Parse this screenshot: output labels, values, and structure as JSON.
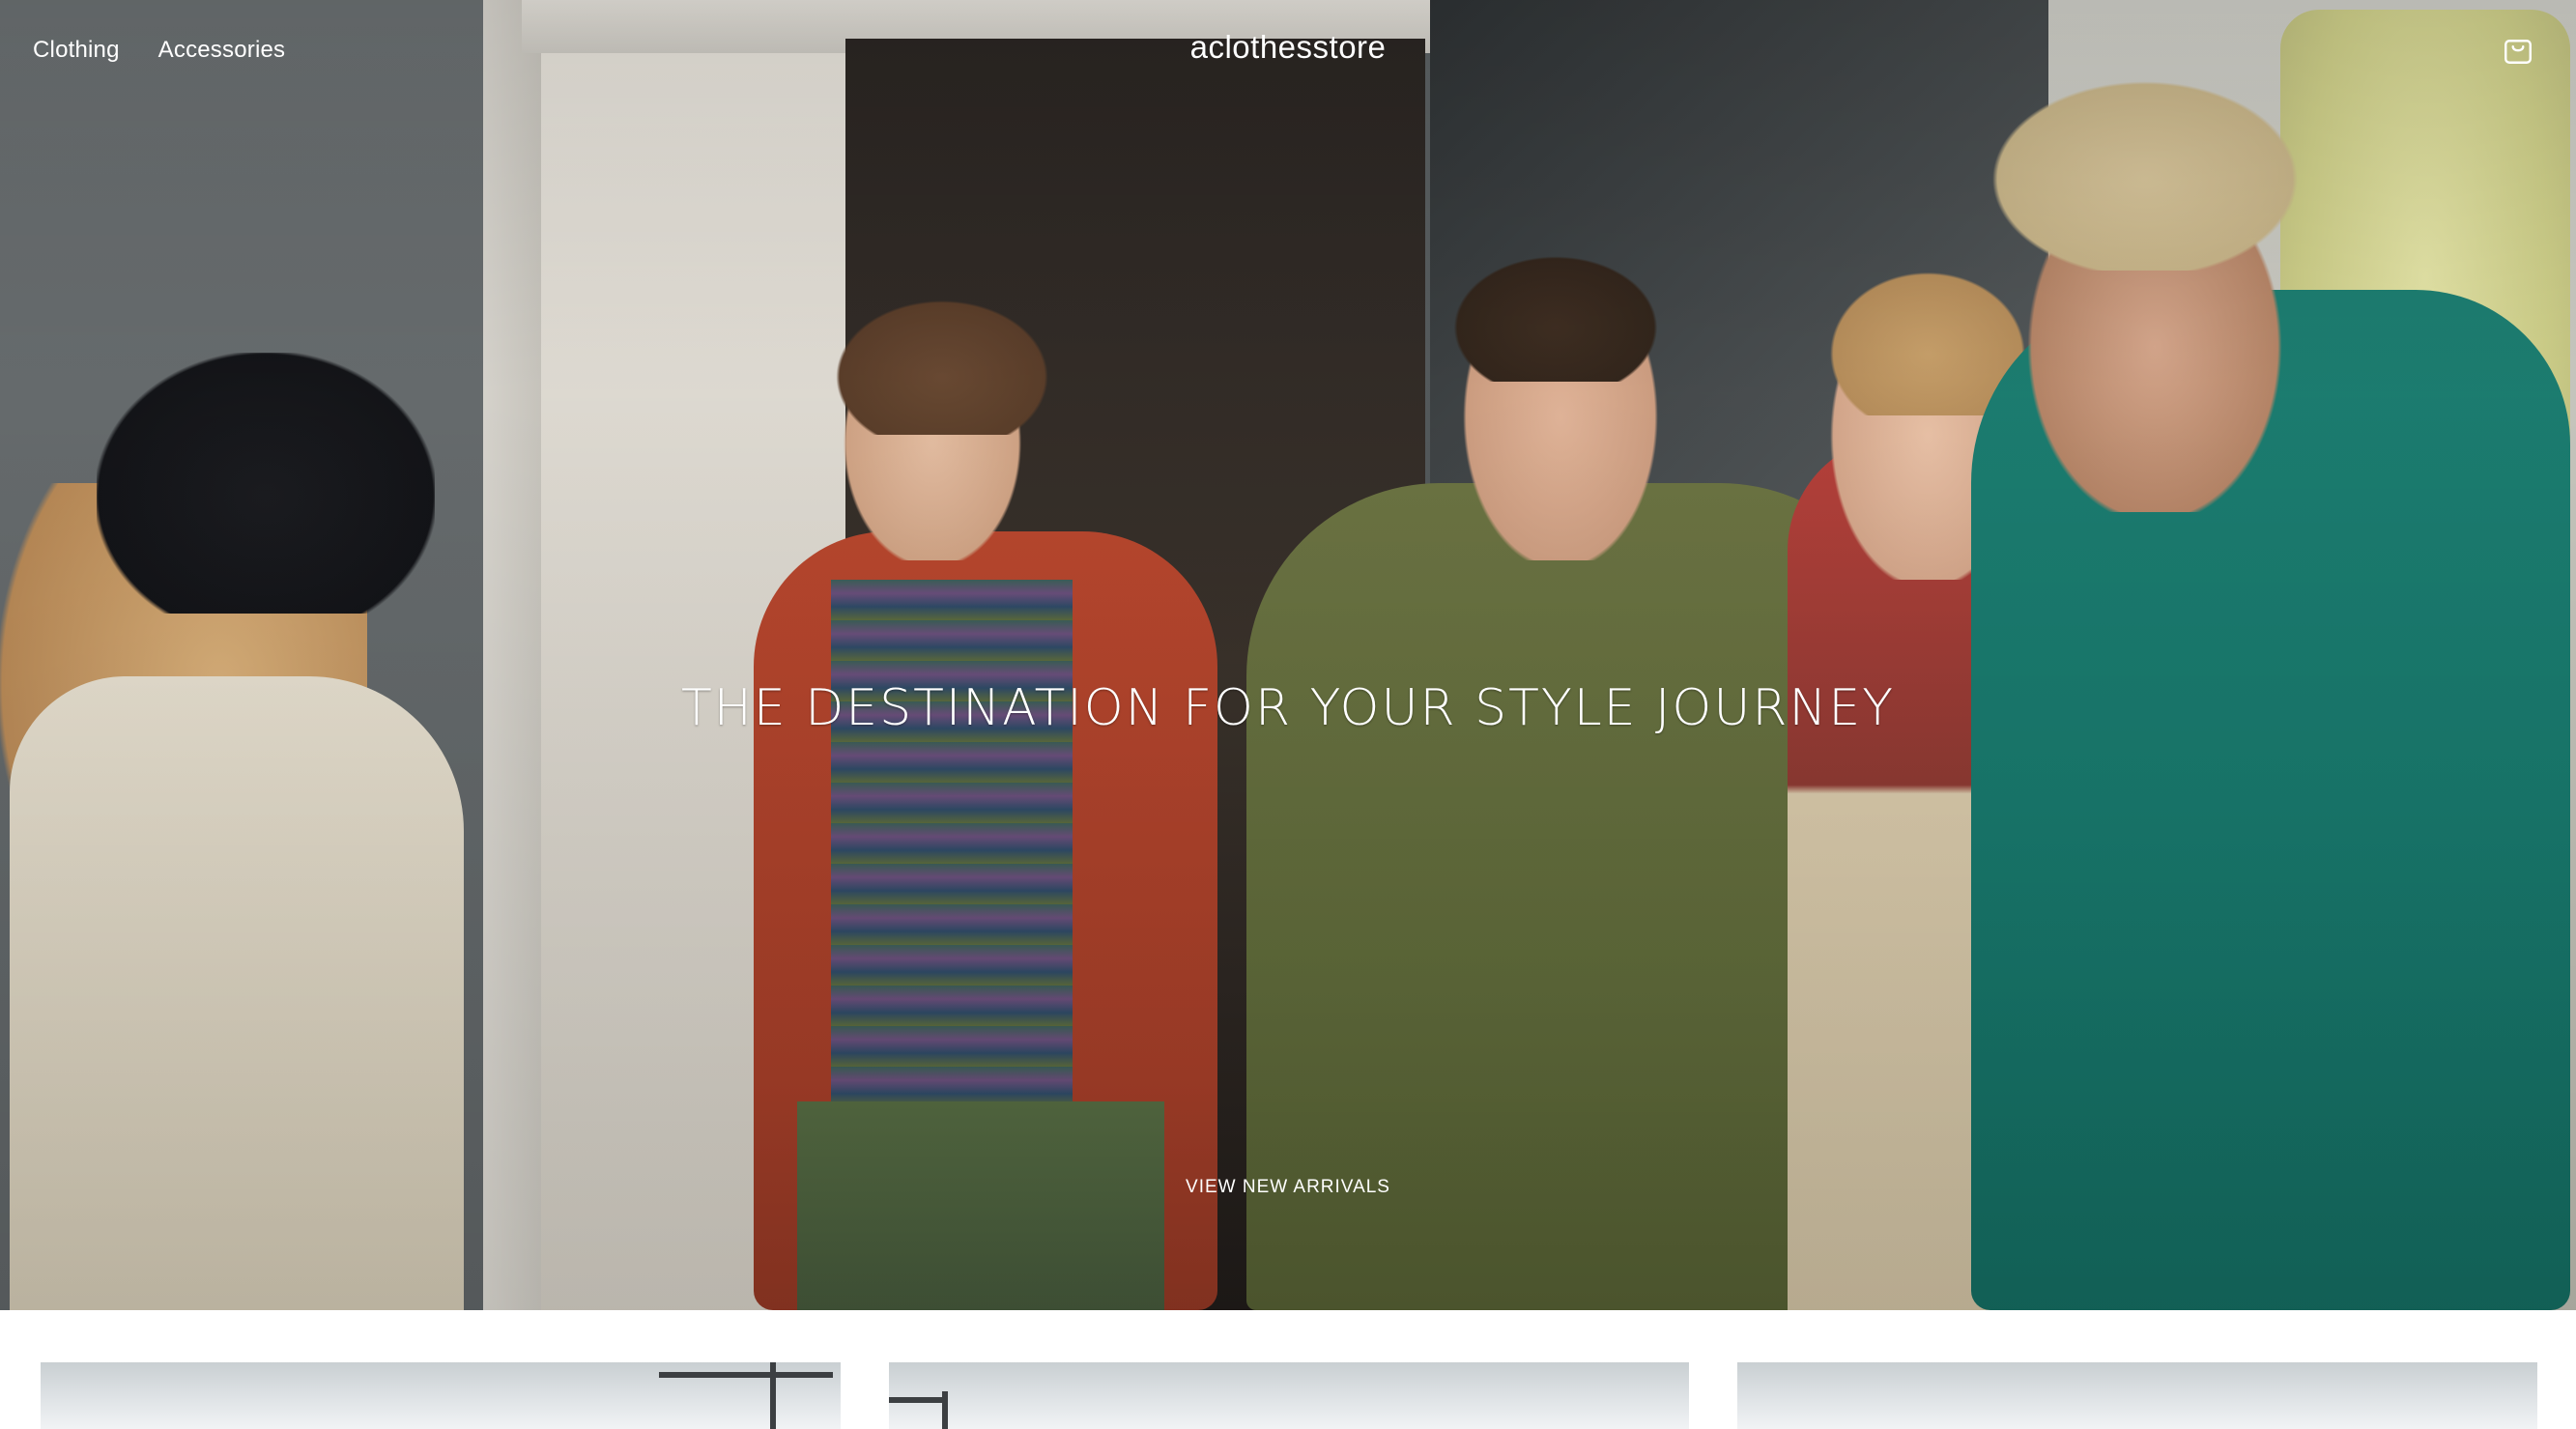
{
  "header": {
    "nav": [
      {
        "label": "Clothing"
      },
      {
        "label": "Accessories"
      }
    ],
    "brand": "aclothesstore",
    "cart_icon": "shopping-bag-icon"
  },
  "hero": {
    "title": "THE DESTINATION FOR YOUR STYLE JOURNEY",
    "cta": "VIEW NEW ARRIVALS"
  },
  "colors": {
    "text_on_hero": "#ffffff",
    "page_background": "#ffffff"
  }
}
